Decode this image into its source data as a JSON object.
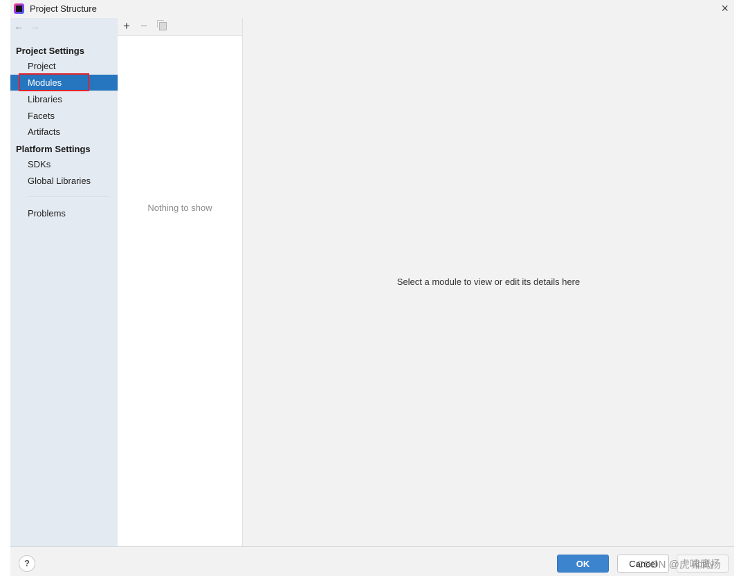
{
  "window": {
    "title": "Project Structure",
    "close_glyph": "×"
  },
  "nav": {
    "back_glyph": "←",
    "forward_glyph": "→"
  },
  "sidebar": {
    "groups": [
      {
        "label": "Project Settings",
        "items": [
          "Project",
          "Modules",
          "Libraries",
          "Facets",
          "Artifacts"
        ]
      },
      {
        "label": "Platform Settings",
        "items": [
          "SDKs",
          "Global Libraries"
        ]
      }
    ],
    "extra_items": [
      "Problems"
    ],
    "selected": "Modules"
  },
  "list_toolbar": {
    "add_glyph": "+",
    "remove_glyph": "−"
  },
  "list": {
    "empty_text": "Nothing to show"
  },
  "detail": {
    "message": "Select a module to view or edit its details here"
  },
  "footer": {
    "help_glyph": "?",
    "ok_label": "OK",
    "cancel_label": "Cancel",
    "apply_label": "Apply",
    "watermark": "CSDN @虎啸鹰扬"
  },
  "colors": {
    "selection": "#2675bf",
    "highlight_box": "#e2232a",
    "ok_button": "#3d84cf"
  }
}
